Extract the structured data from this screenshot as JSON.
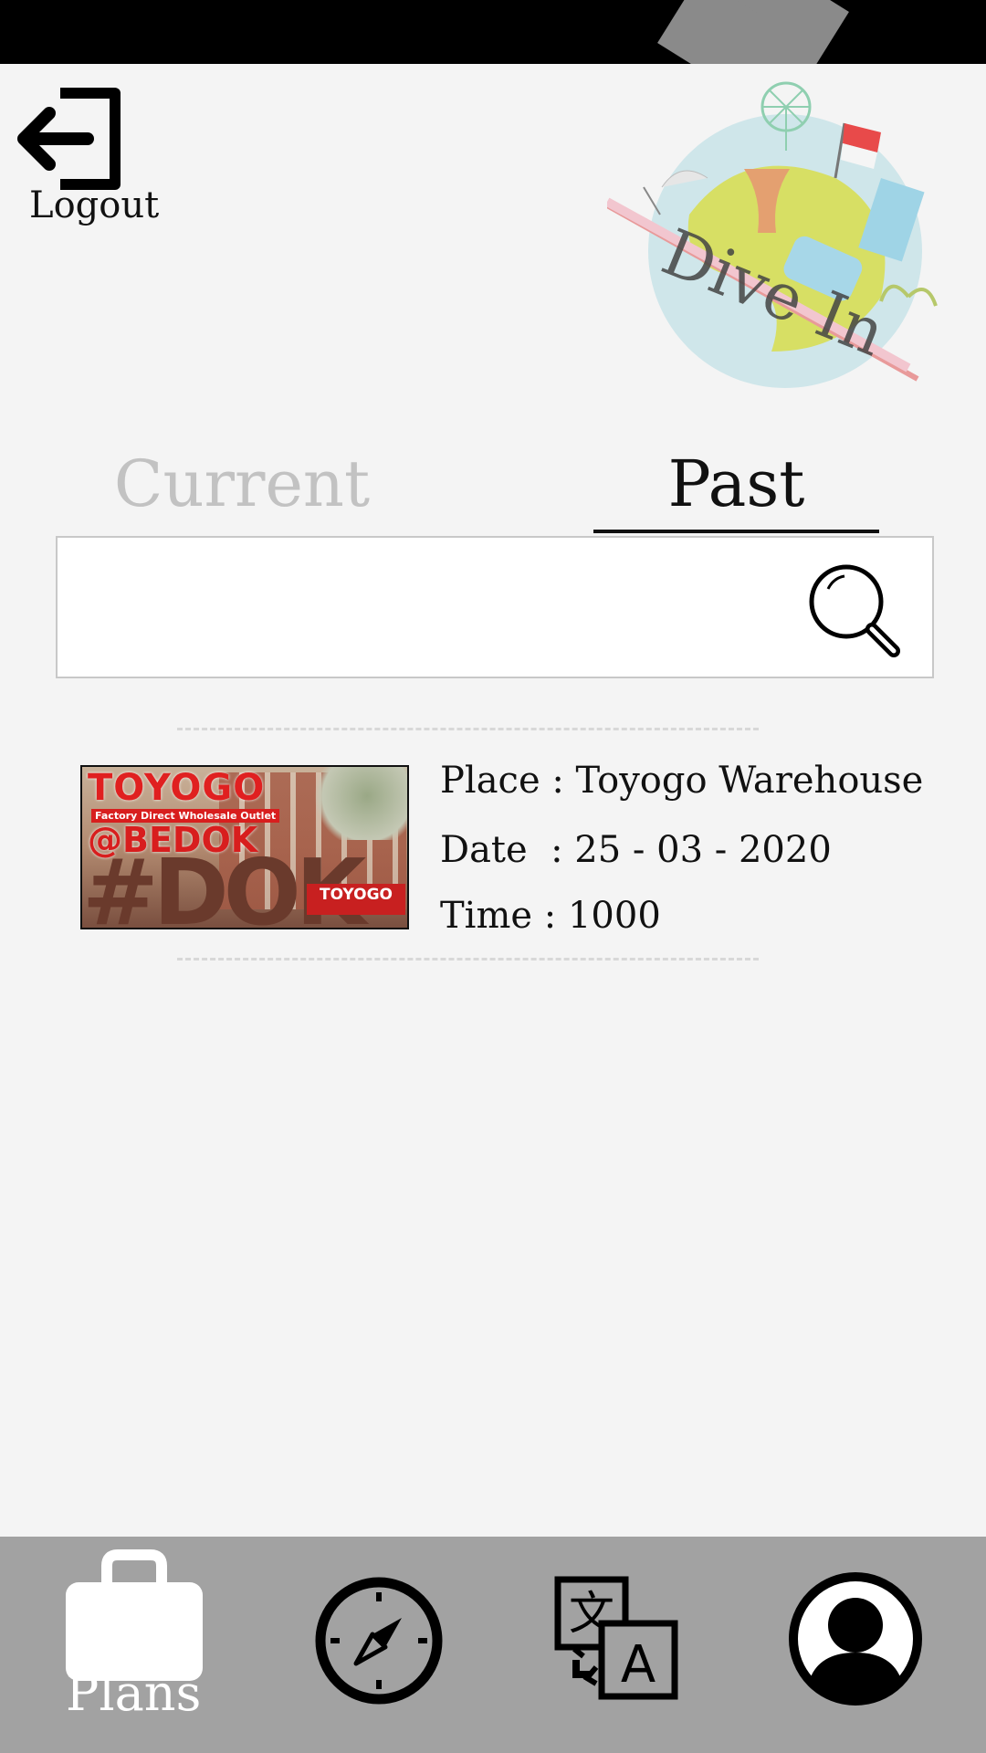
{
  "header": {
    "logout_label": "Logout",
    "logo_text": "Dive In"
  },
  "tabs": [
    {
      "label": "Current",
      "active": false
    },
    {
      "label": "Past",
      "active": true
    }
  ],
  "search": {
    "value": "",
    "placeholder": ""
  },
  "plans": [
    {
      "thumbnail": {
        "brand": "TOYOGO",
        "tagline": "Factory Direct Wholesale Outlet",
        "location": "@BEDOK",
        "letters": "#DOK",
        "sign": "TOYOGO"
      },
      "place": "Place : Toyogo Warehouse",
      "date": "Date  : 25 - 03 - 2020",
      "time": "Time : 1000"
    }
  ],
  "bottom_nav": {
    "items": [
      {
        "label": "Plans",
        "icon": "suitcase-icon",
        "active": true
      },
      {
        "label": "",
        "icon": "compass-icon",
        "active": false
      },
      {
        "label": "",
        "icon": "translate-icon",
        "active": false
      },
      {
        "label": "",
        "icon": "user-profile-icon",
        "active": false
      }
    ]
  },
  "colors": {
    "background": "#f4f4f4",
    "nav_background": "#a2a2a2",
    "active_tab": "#111111",
    "inactive_tab": "#c2c2c2"
  }
}
